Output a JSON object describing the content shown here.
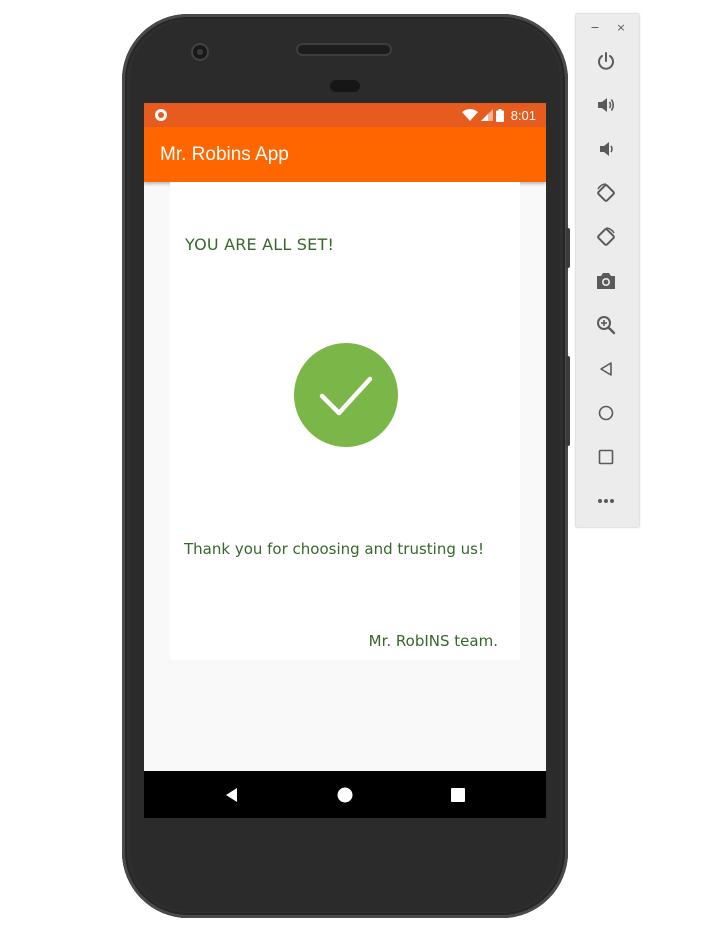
{
  "status_bar": {
    "time": "8:01",
    "icons": [
      "notification-dot-icon",
      "wifi-icon",
      "cellular-signal-icon",
      "battery-icon"
    ]
  },
  "app_bar": {
    "title": "Mr. Robins App"
  },
  "content": {
    "heading": "YOU ARE ALL SET!",
    "icon": "checkmark-circle-icon",
    "message": "Thank you for choosing and trusting us!",
    "signature": "Mr. RobINS team."
  },
  "navigation_bar": {
    "buttons": [
      "back-icon",
      "home-icon",
      "recents-icon"
    ]
  },
  "emulator_toolbar": {
    "window_controls": {
      "minimize": "−",
      "close": "×"
    },
    "buttons": [
      "power-icon",
      "volume-up-icon",
      "volume-down-icon",
      "rotate-left-icon",
      "rotate-right-icon",
      "screenshot-icon",
      "zoom-icon",
      "back-icon",
      "home-icon",
      "overview-icon",
      "more-icon"
    ]
  },
  "colors": {
    "status_bar": "#e65c1e",
    "app_bar": "#ff6600",
    "text_green": "#37672b",
    "check_green": "#7ab648"
  }
}
